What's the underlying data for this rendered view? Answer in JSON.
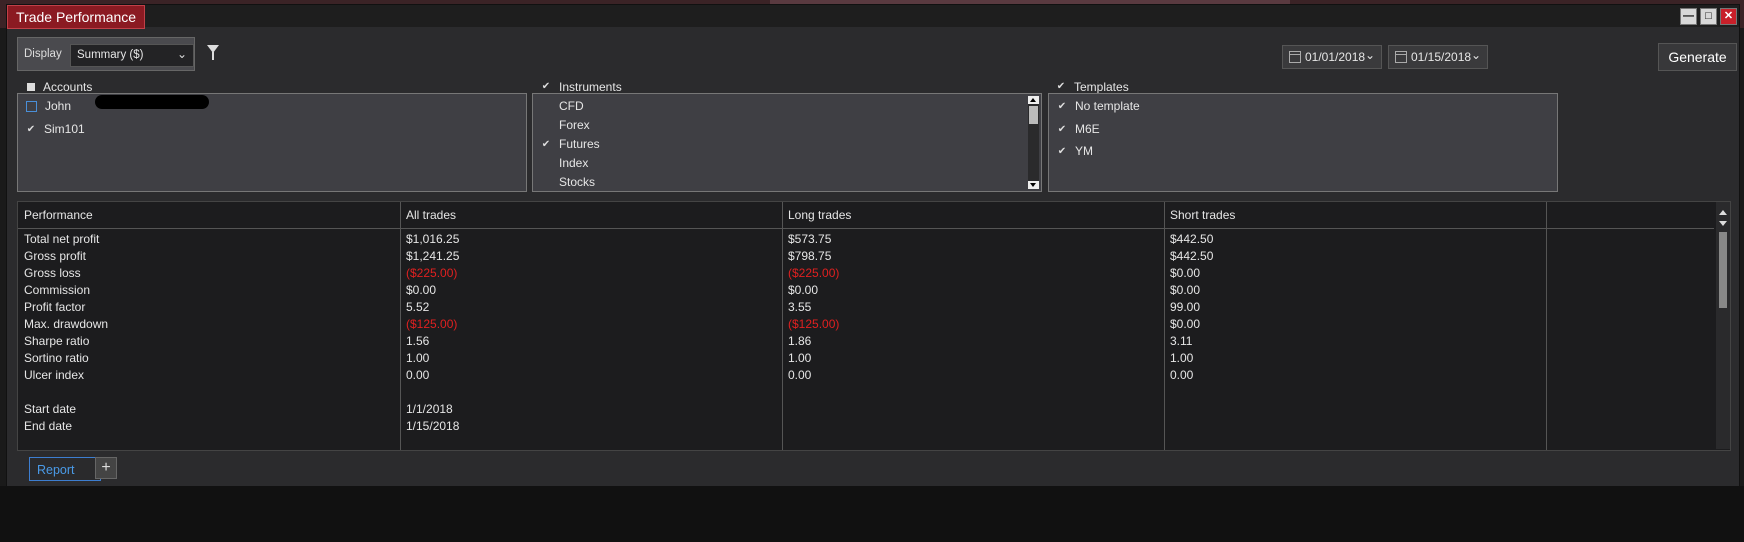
{
  "window": {
    "title": "Trade Performance",
    "minimize": "—",
    "restore": "□",
    "close": "✕"
  },
  "toolbar": {
    "display_label": "Display",
    "display_value": "Summary ($)",
    "date_from": "01/01/2018",
    "date_to": "01/15/2018",
    "generate_label": "Generate"
  },
  "accounts": {
    "label": "Accounts",
    "items": [
      {
        "label": "John",
        "checked": false
      },
      {
        "label": "Sim101",
        "checked": true
      }
    ]
  },
  "instruments": {
    "label": "Instruments",
    "items": [
      {
        "label": "CFD",
        "checked": false
      },
      {
        "label": "Forex",
        "checked": false
      },
      {
        "label": "Futures",
        "checked": true
      },
      {
        "label": "Index",
        "checked": false
      },
      {
        "label": "Stocks",
        "checked": false
      }
    ]
  },
  "templates": {
    "label": "Templates",
    "items": [
      {
        "label": "No template",
        "checked": true
      },
      {
        "label": "M6E",
        "checked": true
      },
      {
        "label": "YM",
        "checked": true
      }
    ]
  },
  "grid": {
    "headers": [
      "Performance",
      "All trades",
      "Long trades",
      "Short trades"
    ],
    "rows": [
      [
        "Total net profit",
        "$1,016.25",
        "$573.75",
        "$442.50"
      ],
      [
        "Gross profit",
        "$1,241.25",
        "$798.75",
        "$442.50"
      ],
      [
        "Gross loss",
        "($225.00)",
        "($225.00)",
        "$0.00"
      ],
      [
        "Commission",
        "$0.00",
        "$0.00",
        "$0.00"
      ],
      [
        "Profit factor",
        "5.52",
        "3.55",
        "99.00"
      ],
      [
        "Max. drawdown",
        "($125.00)",
        "($125.00)",
        "$0.00"
      ],
      [
        "Sharpe ratio",
        "1.56",
        "1.86",
        "3.11"
      ],
      [
        "Sortino ratio",
        "1.00",
        "1.00",
        "1.00"
      ],
      [
        "Ulcer index",
        "0.00",
        "0.00",
        "0.00"
      ],
      [
        "",
        "",
        "",
        ""
      ],
      [
        "Start date",
        "1/1/2018",
        "",
        ""
      ],
      [
        "End date",
        "1/15/2018",
        "",
        ""
      ]
    ]
  },
  "tabs": {
    "report": "Report",
    "add": "+"
  },
  "colors": {
    "title_bg": "#8b1a22",
    "negative": "#e02020",
    "tab_accent": "#3d7ed0"
  }
}
